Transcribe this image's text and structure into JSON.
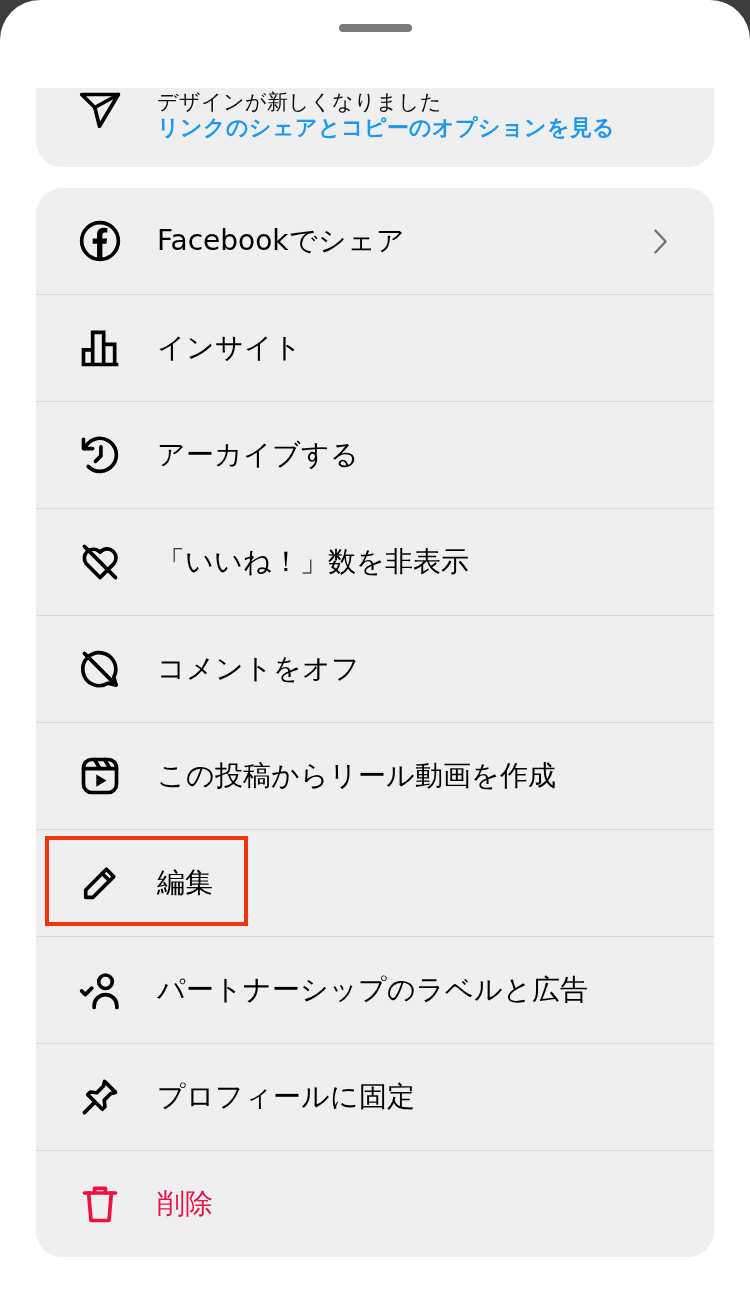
{
  "notice": {
    "title": "デザインが新しくなりました",
    "link": "リンクのシェアとコピーのオプションを見る"
  },
  "menu": {
    "items": [
      {
        "label": "Facebookでシェア",
        "kind": "normal",
        "has_submenu": true,
        "highlighted": false
      },
      {
        "label": "インサイト",
        "kind": "normal",
        "has_submenu": false,
        "highlighted": false
      },
      {
        "label": "アーカイブする",
        "kind": "normal",
        "has_submenu": false,
        "highlighted": false
      },
      {
        "label": "「いいね！」数を非表示",
        "kind": "normal",
        "has_submenu": false,
        "highlighted": false
      },
      {
        "label": "コメントをオフ",
        "kind": "normal",
        "has_submenu": false,
        "highlighted": false
      },
      {
        "label": "この投稿からリール動画を作成",
        "kind": "normal",
        "has_submenu": false,
        "highlighted": false
      },
      {
        "label": "編集",
        "kind": "normal",
        "has_submenu": false,
        "highlighted": true
      },
      {
        "label": "パートナーシップのラベルと広告",
        "kind": "normal",
        "has_submenu": false,
        "highlighted": false
      },
      {
        "label": "プロフィールに固定",
        "kind": "normal",
        "has_submenu": false,
        "highlighted": false
      },
      {
        "label": "削除",
        "kind": "destructive",
        "has_submenu": false,
        "highlighted": false
      }
    ]
  }
}
